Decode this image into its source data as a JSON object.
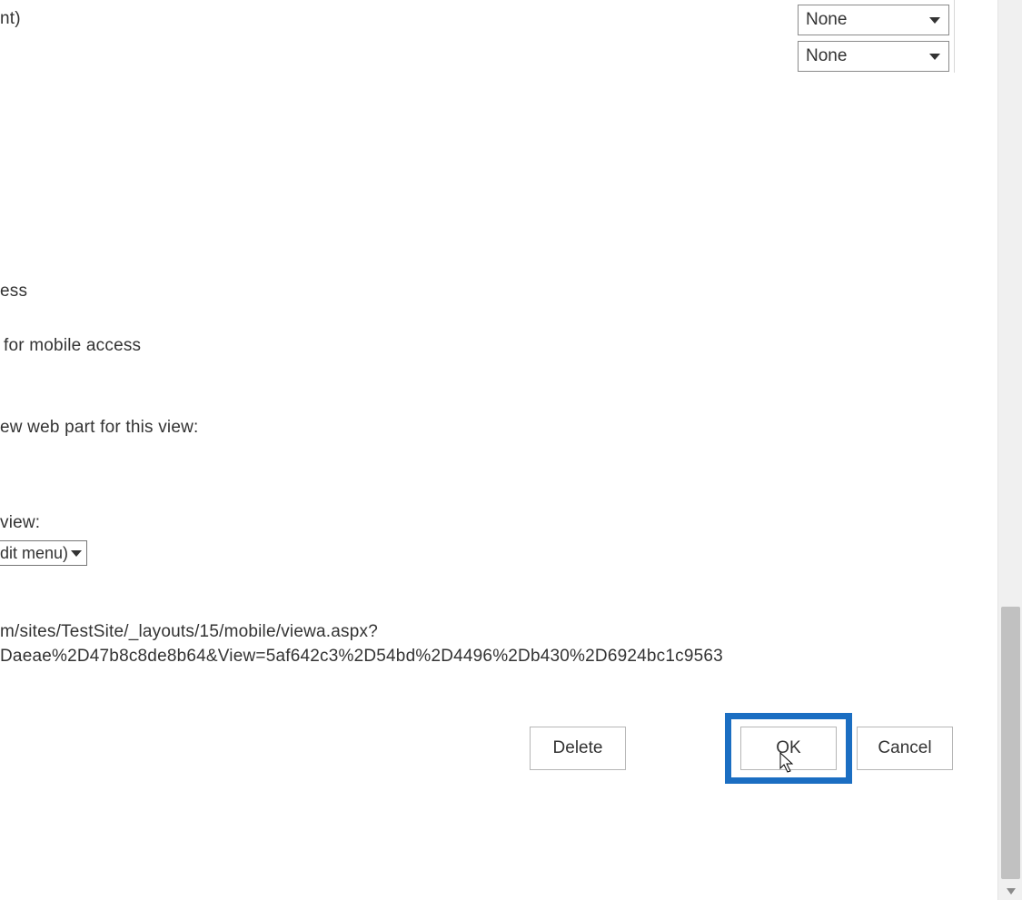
{
  "dropdowns": {
    "sort1": {
      "value": "None"
    },
    "sort2": {
      "value": "None"
    }
  },
  "fragments": {
    "nt": "nt)",
    "ess": "ess",
    "mobile_access": " for mobile access",
    "web_part": "ew web part for this view:",
    "view_label": "view:",
    "partial_select": "dit menu)",
    "url_line1": "m/sites/TestSite/_layouts/15/mobile/viewa.aspx?",
    "url_line2": "Daeae%2D47b8c8de8b64&View=5af642c3%2D54bd%2D4496%2Db430%2D6924bc1c9563"
  },
  "buttons": {
    "delete": "Delete",
    "ok": "OK",
    "cancel": "Cancel"
  }
}
